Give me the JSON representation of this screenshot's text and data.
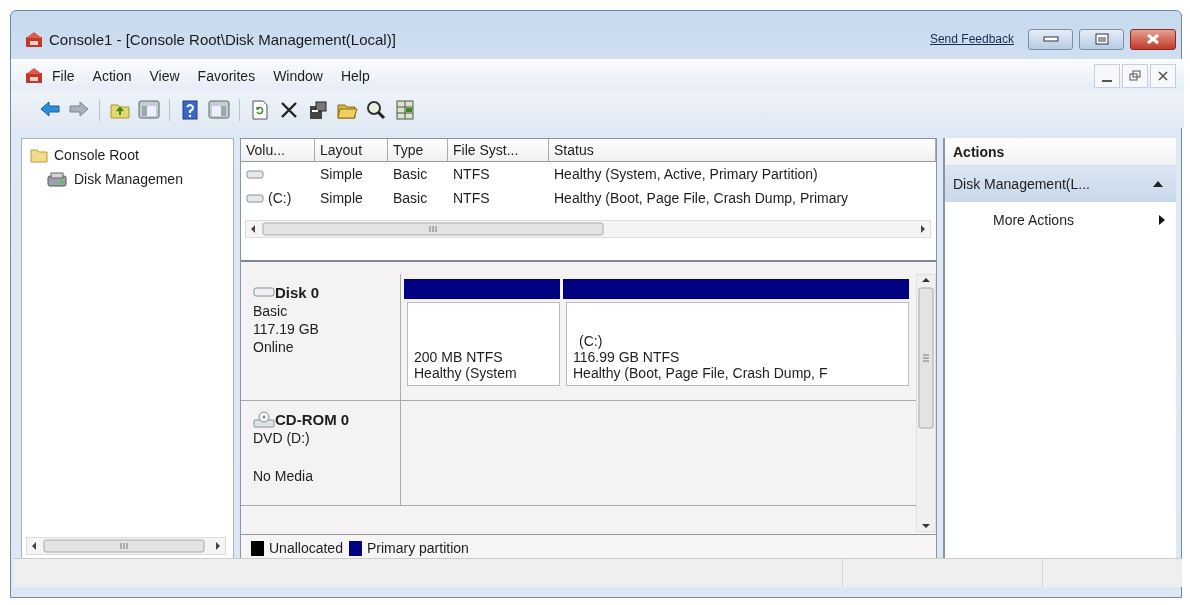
{
  "window": {
    "title": "Console1 - [Console Root\\Disk Management(Local)]",
    "send_feedback": "Send Feedback"
  },
  "menu": [
    "File",
    "Action",
    "View",
    "Favorites",
    "Window",
    "Help"
  ],
  "tree": {
    "items": [
      {
        "label": "Console Root",
        "children": [
          {
            "label": "Disk Managemen"
          }
        ]
      }
    ]
  },
  "volume_table": {
    "columns": [
      "Volu...",
      "Layout",
      "Type",
      "File Syst...",
      "Status"
    ],
    "rows": [
      {
        "layout": "Simple",
        "type": "Basic",
        "file_system": "NTFS",
        "status": "Healthy (System, Active, Primary Partition)"
      },
      {
        "volume": "(C:)",
        "layout": "Simple",
        "type": "Basic",
        "file_system": "NTFS",
        "status": "Healthy (Boot, Page File, Crash Dump, Primary"
      }
    ]
  },
  "disks": [
    {
      "kind": "disk",
      "name": "Disk 0",
      "lines": [
        "Basic",
        "117.19 GB",
        "Online"
      ],
      "partitions": [
        {
          "color": "#000080",
          "lines": [
            "200 MB NTFS",
            "Healthy (System"
          ]
        },
        {
          "color": "#000080",
          "label": "(C:)",
          "lines": [
            "116.99 GB NTFS",
            "Healthy (Boot, Page File, Crash Dump, F"
          ]
        }
      ]
    },
    {
      "kind": "cdrom",
      "name": "CD-ROM 0",
      "type": "DVD (D:)",
      "status": "No Media"
    }
  ],
  "legend": [
    {
      "label": "Unallocated",
      "color": "#000000"
    },
    {
      "label": "Primary partition",
      "color": "#000080"
    }
  ],
  "actions": {
    "title": "Actions",
    "sections": [
      {
        "label": "Disk Management(L...",
        "expanded": true,
        "items": [
          {
            "label": "More Actions"
          }
        ]
      }
    ]
  }
}
